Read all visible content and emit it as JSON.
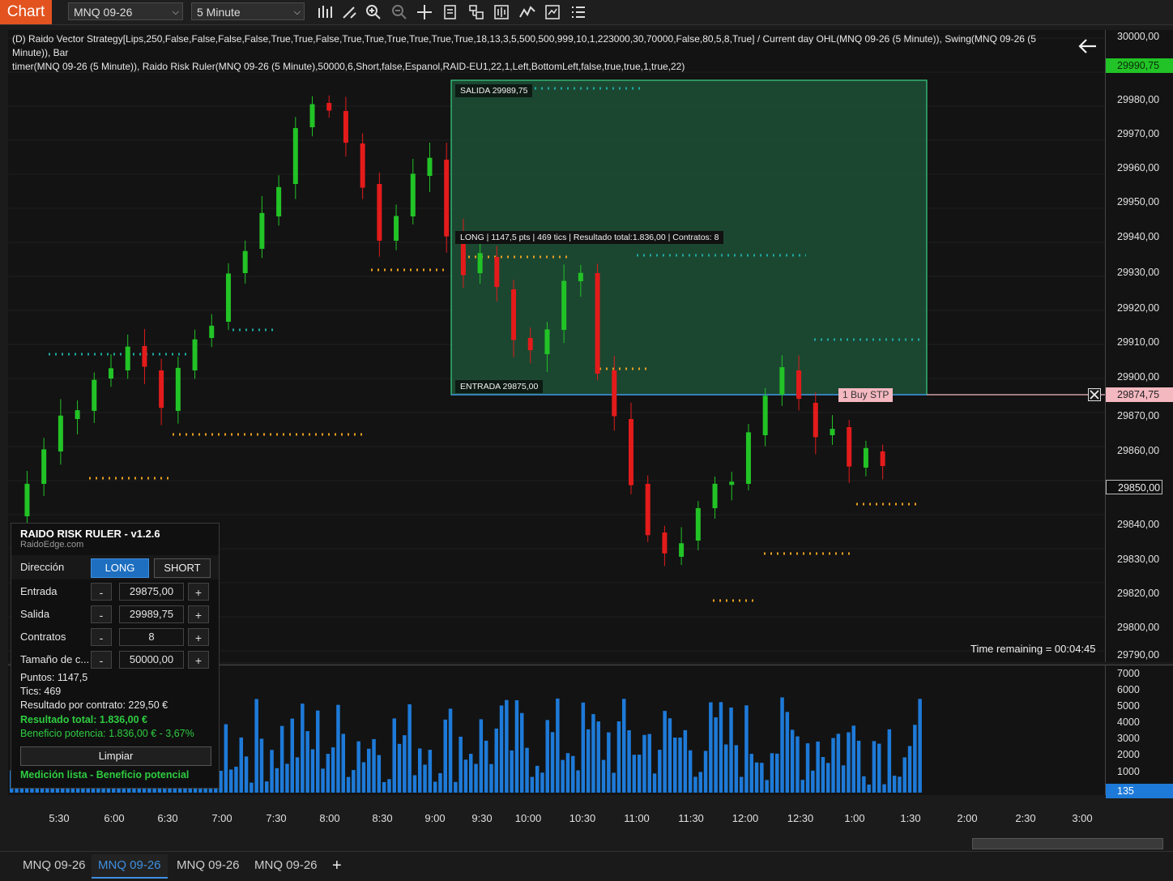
{
  "toolbar": {
    "chart_tab": "Chart",
    "instrument": "MNQ 09-26",
    "interval": "5 Minute",
    "icons": [
      "bar-type-icon",
      "drawing-tools-icon",
      "zoom-in-icon",
      "zoom-out-icon",
      "crosshair-icon",
      "data-box-icon",
      "strategy-icon",
      "chart-trader-icon",
      "indicators-icon",
      "properties-icon",
      "list-icon"
    ]
  },
  "indicator_text": [
    "(D) Raido Vector Strategy[Lips,250,False,False,False,False,True,True,False,True,True,True,True,True,True,18,13,3,5,500,500,999,10,1,223000,30,70000,False,80,5,8,True] / Current day OHL(MNQ 09-26 (5 Minute)), Swing(MNQ 09-26 (5 Minute)), Bar",
    "timer(MNQ 09-26 (5 Minute)), Raido Risk Ruler(MNQ 09-26 (5 Minute),50000,6,Short,false,Espanol,RAID-EU1,22,1,Left,BottomLeft,false,true,true,1,true,22)"
  ],
  "price_axis": {
    "labels": [
      "30000,00",
      "29980,00",
      "29970,00",
      "29960,00",
      "29950,00",
      "29940,00",
      "29930,00",
      "29920,00",
      "29910,00",
      "29900,00",
      "29870,00",
      "29860,00",
      "29840,00",
      "29830,00",
      "29820,00",
      "29800,00",
      "29790,00"
    ],
    "tags": {
      "ask": "29990,75",
      "order": "29874,75",
      "last": "29850,00"
    }
  },
  "volume_axis": {
    "labels": [
      "7000",
      "6000",
      "5000",
      "4000",
      "3000",
      "2000",
      "1000"
    ],
    "current": "135"
  },
  "time_axis": [
    "5:30",
    "6:00",
    "6:30",
    "7:00",
    "7:30",
    "8:00",
    "8:30",
    "9:00",
    "9:30",
    "10:00",
    "10:30",
    "11:00",
    "11:30",
    "12:00",
    "12:30",
    "1:00",
    "1:30",
    "2:00",
    "2:30",
    "3:00"
  ],
  "ruler_box": {
    "salida_label": "SALIDA  29989,75",
    "entrada_label": "ENTRADA  29875,00",
    "summary": "LONG  |  1147,5 pts  |  469 tics  |  Resultado total:1.836,00  |  Contratos: 8"
  },
  "order_marker": "1 Buy STP",
  "time_remaining": "Time remaining = 00:04:45",
  "risk_panel": {
    "title": "RAIDO RISK RULER - v1.2.6",
    "site": "RaidoEdge.com",
    "direction_label": "Dirección",
    "long": "LONG",
    "short": "SHORT",
    "fields": [
      {
        "label": "Entrada",
        "value": "29875,00"
      },
      {
        "label": "Salida",
        "value": "29989,75"
      },
      {
        "label": "Contratos",
        "value": "8"
      },
      {
        "label": "Tamaño de c...",
        "value": "50000,00"
      }
    ],
    "minus": "-",
    "plus": "+",
    "puntos": "Puntos: 1147,5",
    "tics": "Tics:  469",
    "per_contract": "Resultado por contrato: 229,50 €",
    "total": "Resultado total: 1.836,00 €",
    "potential": "Beneficio potencia: 1.836,00 € - 3,67%",
    "clear": "Limpiar",
    "status": "Medición lista - Beneficio potencial"
  },
  "bottom_tabs": [
    "MNQ 09-26",
    "MNQ 09-26",
    "MNQ 09-26",
    "MNQ 09-26"
  ],
  "add_tab": "+",
  "colors": {
    "up": "#22c326",
    "down": "#e31b1b",
    "volume": "#1e7ad8",
    "accent": "#e2531f",
    "ruler_fill": "#1f5a3c",
    "ruler_border": "#3bd186"
  }
}
